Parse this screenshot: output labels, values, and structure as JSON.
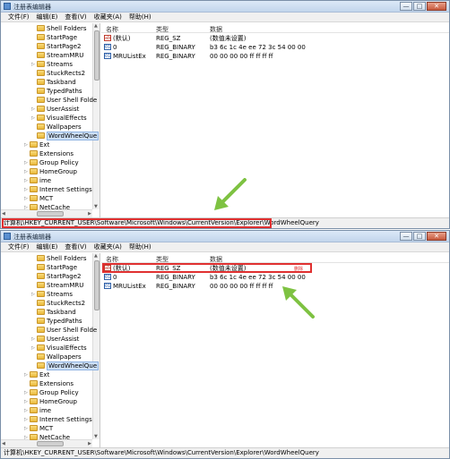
{
  "window": {
    "title": "注册表编辑器",
    "buttons": {
      "minimize": "—",
      "maximize": "□",
      "close": "✕"
    },
    "menu": [
      "文件(F)",
      "编辑(E)",
      "查看(V)",
      "收藏夹(A)",
      "帮助(H)"
    ]
  },
  "tree": {
    "items": [
      {
        "label": "Shell Folders",
        "indent": 2,
        "arrow": ""
      },
      {
        "label": "StartPage",
        "indent": 2,
        "arrow": ""
      },
      {
        "label": "StartPage2",
        "indent": 2,
        "arrow": ""
      },
      {
        "label": "StreamMRU",
        "indent": 2,
        "arrow": ""
      },
      {
        "label": "Streams",
        "indent": 2,
        "arrow": "▷"
      },
      {
        "label": "StuckRects2",
        "indent": 2,
        "arrow": ""
      },
      {
        "label": "Taskband",
        "indent": 2,
        "arrow": ""
      },
      {
        "label": "TypedPaths",
        "indent": 2,
        "arrow": ""
      },
      {
        "label": "User Shell Folde",
        "indent": 2,
        "arrow": ""
      },
      {
        "label": "UserAssist",
        "indent": 2,
        "arrow": "▷"
      },
      {
        "label": "VisualEffects",
        "indent": 2,
        "arrow": "▷"
      },
      {
        "label": "Wallpapers",
        "indent": 2,
        "arrow": ""
      },
      {
        "label": "WordWheelQue",
        "indent": 2,
        "arrow": "",
        "selected": true
      },
      {
        "label": "Ext",
        "indent": 1,
        "arrow": "▷"
      },
      {
        "label": "Extensions",
        "indent": 1,
        "arrow": ""
      },
      {
        "label": "Group Policy",
        "indent": 1,
        "arrow": "▷"
      },
      {
        "label": "HomeGroup",
        "indent": 1,
        "arrow": "▷"
      },
      {
        "label": "ime",
        "indent": 1,
        "arrow": "▷"
      },
      {
        "label": "Internet Settings",
        "indent": 1,
        "arrow": "▷"
      },
      {
        "label": "MCT",
        "indent": 1,
        "arrow": "▷"
      },
      {
        "label": "NetCache",
        "indent": 1,
        "arrow": "▷"
      }
    ]
  },
  "list": {
    "columns": {
      "name": "名称",
      "type": "类型",
      "data": "数据"
    },
    "rows": [
      {
        "icon": "string-value-icon",
        "name": "(默认)",
        "type": "REG_SZ",
        "data": "(数值未设置)"
      },
      {
        "icon": "binary-value-icon",
        "name": "0",
        "type": "REG_BINARY",
        "data": "b3 6c 1c 4e ee 72 3c 54 00 00"
      },
      {
        "icon": "binary-value-icon",
        "name": "MRUListEx",
        "type": "REG_BINARY",
        "data": "00 00 00 00 ff ff ff ff"
      }
    ]
  },
  "status": {
    "path": "计算机\\HKEY_CURRENT_USER\\Software\\Microsoft\\Windows\\CurrentVersion\\Explorer\\WordWheelQuery"
  },
  "annotations": {
    "delete_note": "删除",
    "highlight_color": "#e03030",
    "arrow_color": "#7ec242"
  }
}
